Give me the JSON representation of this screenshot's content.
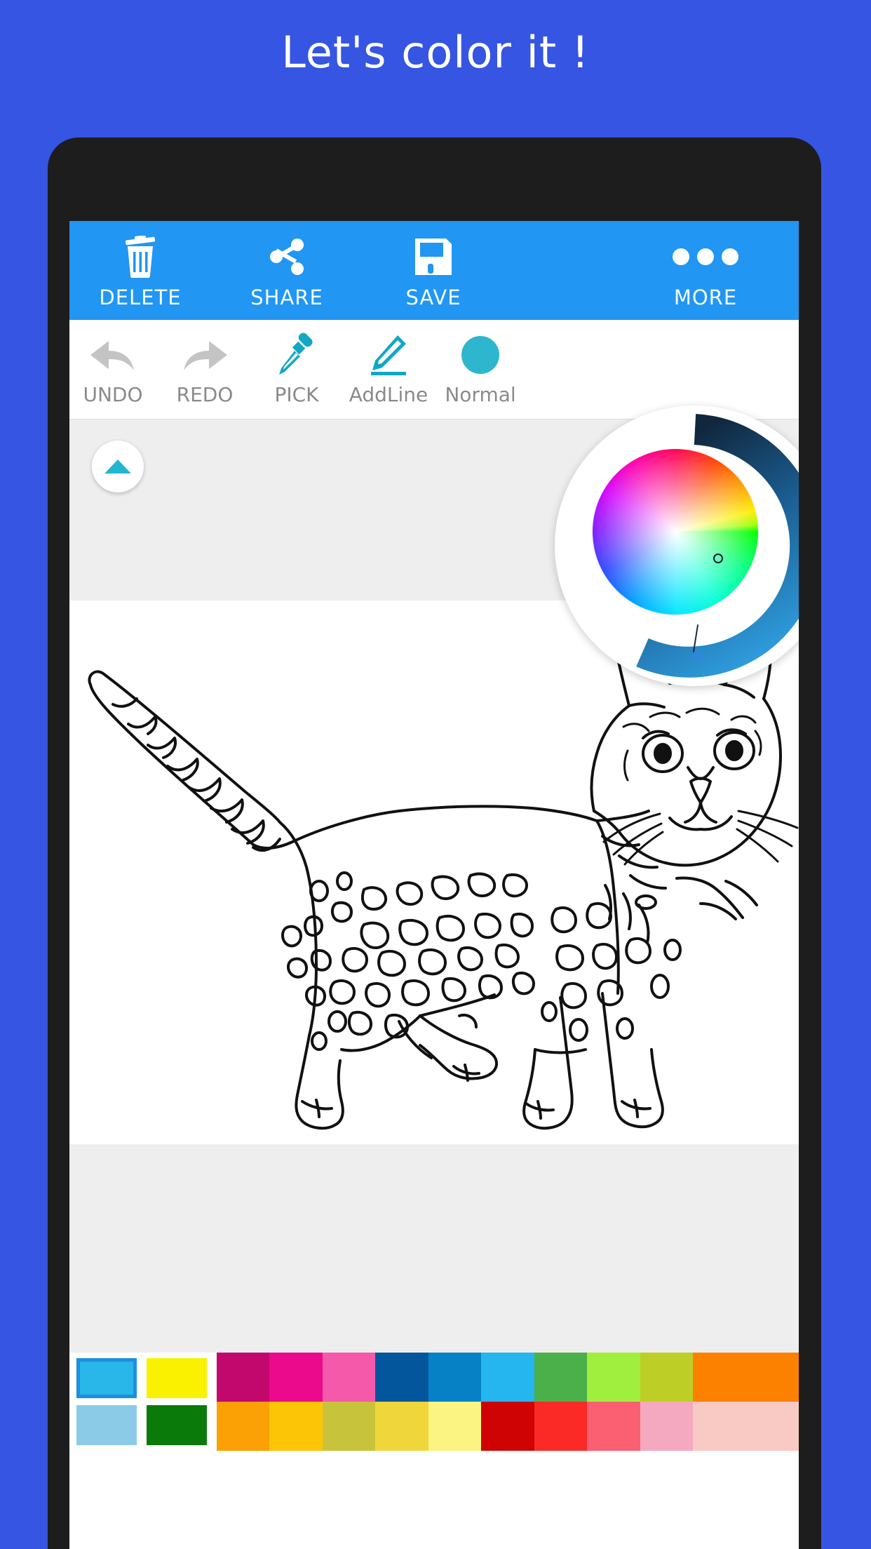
{
  "promo": {
    "title": "Let's color it !",
    "background_color": "#3555e2",
    "title_color": "#ffffff"
  },
  "phone": {
    "bezel_color": "#1d1d1d",
    "screen_background": "#ffffff"
  },
  "app_bar": {
    "background_color": "#2196f3",
    "items": [
      {
        "label": "DELETE",
        "icon": "trash-icon"
      },
      {
        "label": "SHARE",
        "icon": "share-icon"
      },
      {
        "label": "SAVE",
        "icon": "floppy-disk-icon"
      },
      {
        "label": "MORE",
        "icon": "overflow-dots-icon"
      }
    ]
  },
  "tool_bar": {
    "background_color": "#ffffff",
    "disabled_color": "#bdbdbd",
    "active_color": "#11a8c4",
    "label_color": "#8a8a8a",
    "items": [
      {
        "label": "UNDO",
        "icon": "undo-arrow-icon",
        "state": "disabled"
      },
      {
        "label": "REDO",
        "icon": "redo-arrow-icon",
        "state": "disabled"
      },
      {
        "label": "PICK",
        "icon": "eyedropper-icon",
        "state": "active"
      },
      {
        "label": "AddLine",
        "icon": "pencil-icon",
        "state": "active"
      },
      {
        "label": "Normal",
        "icon": "filled-circle-icon",
        "state": "active"
      }
    ]
  },
  "canvas": {
    "background_color": "#eeeeee",
    "sheet_color": "#ffffff",
    "artwork": "cat-line-art-coloring-page",
    "collapse_button_icon": "triangle-up-icon",
    "collapse_button_color": "#21b8cf"
  },
  "color_wheel": {
    "panel_color": "#ffffff",
    "selected_color": "#29b6e8",
    "arc_from": "#10273d",
    "arc_to": "#2f9fe0",
    "selector_icon": "wheel-selector-icon",
    "handle_icon": "brightness-handle-icon"
  },
  "palette": {
    "recent": [
      {
        "color": "#29b6e8",
        "selected": true
      },
      {
        "color": "#faf100",
        "selected": false
      },
      {
        "color": "#8ccbe8",
        "selected": false
      },
      {
        "color": "#0a7a0a",
        "selected": false
      }
    ],
    "row_top": [
      "#c2076d",
      "#ec0a8c",
      "#f459aa",
      "#04569c",
      "#0681c6",
      "#25b6ef",
      "#4bb04a",
      "#a0ef3e",
      "#bdce26",
      "#fc8100",
      "#fc8100"
    ],
    "row_bottom": [
      "#fba106",
      "#fcc506",
      "#c7c43b",
      "#efd63a",
      "#fbf483",
      "#cf0303",
      "#fb2a27",
      "#fb5f72",
      "#f5a9c0",
      "#f9cac4",
      "#f9cac4"
    ]
  }
}
